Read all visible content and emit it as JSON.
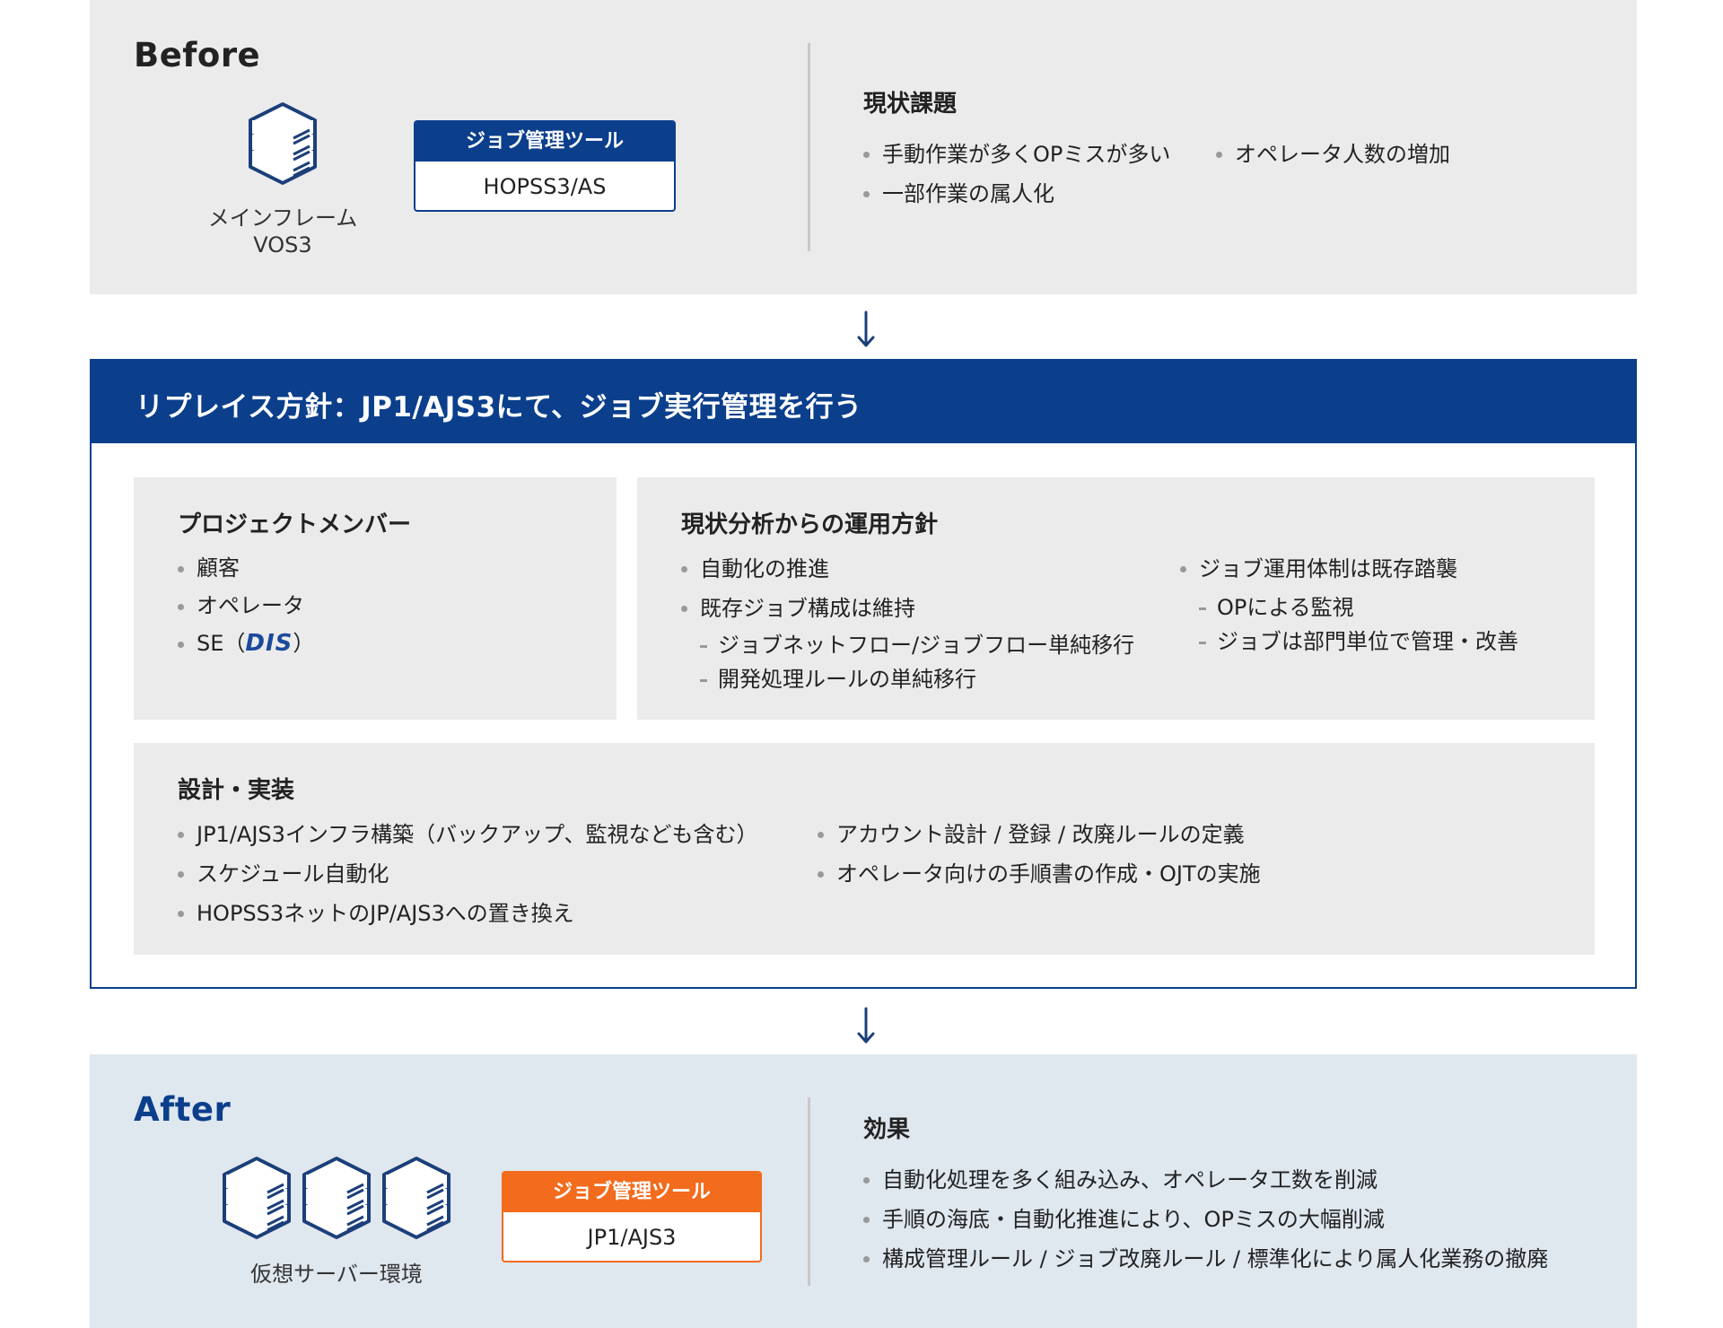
{
  "before": {
    "title": "Before",
    "mainframe_caption": [
      "メインフレーム",
      "VOS3"
    ],
    "tool": {
      "header": "ジョブ管理ツール",
      "name": "HOPSS3/AS",
      "color": "#0b3f8c"
    },
    "issues_title": "現状課題",
    "issues_left": [
      "手動作業が多くOPミスが多い",
      "一部作業の属人化"
    ],
    "issues_right": [
      "オペレータ人数の増加"
    ]
  },
  "policy": {
    "title": "リプレイス方針：JP1/AJS3にて、ジョブ実行管理を行う",
    "header_color": "#0b3f8c",
    "members": {
      "title": "プロジェクトメンバー",
      "items": [
        "顧客",
        "オペレータ"
      ],
      "se_prefix": "SE（",
      "se_logo": "DIS",
      "se_suffix": "）"
    },
    "analysis": {
      "title": "現状分析からの運用方針",
      "col1_item1": "自動化の推進",
      "col1_item2": "既存ジョブ構成は維持",
      "col1_subs": [
        "ジョブネットフロー/ジョブフロー単純移行",
        "開発処理ルールの単純移行"
      ],
      "col2_item1": "ジョブ運用体制は既存踏襲",
      "col2_subs": [
        "OPによる監視",
        "ジョブは部門単位で管理・改善"
      ]
    },
    "design": {
      "title": "設計・実装",
      "left": [
        "JP1/AJS3インフラ構築（バックアップ、監視なども含む）",
        "スケジュール自動化",
        "HOPSS3ネットのJP/AJS3への置き換え"
      ],
      "right": [
        "アカウント設計 / 登録 / 改廃ルールの定義",
        "オペレータ向けの手順書の作成・OJTの実施"
      ]
    }
  },
  "after": {
    "title": "After",
    "servers_caption": "仮想サーバー環境",
    "tool": {
      "header": "ジョブ管理ツール",
      "name": "JP1/AJS3",
      "color": "#f36b1c"
    },
    "effects_title": "効果",
    "effects": [
      "自動化処理を多く組み込み、オペレータ工数を削減",
      "手順の海底・自動化推進により、OPミスの大幅削減",
      "構成管理ルール / ジョブ改廃ルール / 標準化により属人化業務の撤廃"
    ]
  },
  "colors": {
    "navy": "#0b3f8c",
    "orange": "#f36b1c",
    "panel_gray": "#ebebeb",
    "panel_blue": "#dfe7ef"
  },
  "icons": [
    "server-stack-icon",
    "down-arrow-icon",
    "bullet-dot-icon"
  ]
}
